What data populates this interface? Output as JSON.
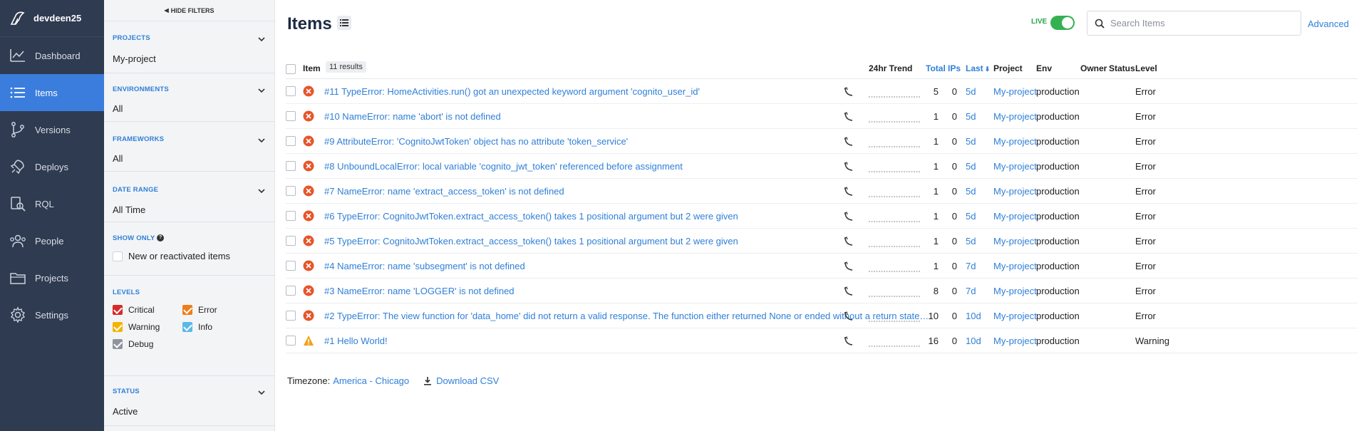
{
  "nav": {
    "account": "devdeen25",
    "items": [
      {
        "label": "Dashboard",
        "icon": "chart-line-icon"
      },
      {
        "label": "Items",
        "icon": "list-icon",
        "active": true
      },
      {
        "label": "Versions",
        "icon": "branch-icon"
      },
      {
        "label": "Deploys",
        "icon": "rocket-icon"
      },
      {
        "label": "RQL",
        "icon": "query-icon"
      },
      {
        "label": "People",
        "icon": "people-icon"
      },
      {
        "label": "Projects",
        "icon": "folder-icon"
      },
      {
        "label": "Settings",
        "icon": "gear-icon"
      }
    ]
  },
  "filters": {
    "hide_label": "HIDE FILTERS",
    "projects": {
      "title": "PROJECTS",
      "value": "My-project"
    },
    "environments": {
      "title": "ENVIRONMENTS",
      "value": "All"
    },
    "frameworks": {
      "title": "FRAMEWORKS",
      "value": "All"
    },
    "date_range": {
      "title": "DATE RANGE",
      "value": "All Time"
    },
    "show_only": {
      "title": "SHOW ONLY",
      "option": "New or reactivated items",
      "checked": false
    },
    "levels": {
      "title": "LEVELS",
      "items": [
        {
          "label": "Critical",
          "color": "#d62b2b",
          "checked": true
        },
        {
          "label": "Error",
          "color": "#f07c1b",
          "checked": true
        },
        {
          "label": "Warning",
          "color": "#f4b400",
          "checked": true
        },
        {
          "label": "Info",
          "color": "#5bb9e6",
          "checked": true
        },
        {
          "label": "Debug",
          "color": "#8f959e",
          "checked": true
        }
      ]
    },
    "status": {
      "title": "STATUS",
      "value": "Active"
    }
  },
  "main": {
    "title": "Items",
    "live_label": "LIVE",
    "live_on": true,
    "search_placeholder": "Search Items",
    "advanced_label": "Advanced",
    "columns": {
      "item": "Item",
      "results": "11 results",
      "trend": "24hr Trend",
      "total": "Total",
      "ips": "IPs",
      "last": "Last",
      "project": "Project",
      "env": "Env",
      "owner": "Owner",
      "status": "Status",
      "level": "Level"
    },
    "rows": [
      {
        "title": "#11 TypeError: HomeActivities.run() got an unexpected keyword argument 'cognito_user_id'",
        "total": "5",
        "ips": "0",
        "last": "5d",
        "project": "My-project",
        "env": "production",
        "level": "Error",
        "kind": "error"
      },
      {
        "title": "#10 NameError: name 'abort' is not defined",
        "total": "1",
        "ips": "0",
        "last": "5d",
        "project": "My-project",
        "env": "production",
        "level": "Error",
        "kind": "error"
      },
      {
        "title": "#9 AttributeError: 'CognitoJwtToken' object has no attribute 'token_service'",
        "total": "1",
        "ips": "0",
        "last": "5d",
        "project": "My-project",
        "env": "production",
        "level": "Error",
        "kind": "error"
      },
      {
        "title": "#8 UnboundLocalError: local variable 'cognito_jwt_token' referenced before assignment",
        "total": "1",
        "ips": "0",
        "last": "5d",
        "project": "My-project",
        "env": "production",
        "level": "Error",
        "kind": "error"
      },
      {
        "title": "#7 NameError: name 'extract_access_token' is not defined",
        "total": "1",
        "ips": "0",
        "last": "5d",
        "project": "My-project",
        "env": "production",
        "level": "Error",
        "kind": "error"
      },
      {
        "title": "#6 TypeError: CognitoJwtToken.extract_access_token() takes 1 positional argument but 2 were given",
        "total": "1",
        "ips": "0",
        "last": "5d",
        "project": "My-project",
        "env": "production",
        "level": "Error",
        "kind": "error"
      },
      {
        "title": "#5 TypeError: CognitoJwtToken.extract_access_token() takes 1 positional argument but 2 were given",
        "total": "1",
        "ips": "0",
        "last": "5d",
        "project": "My-project",
        "env": "production",
        "level": "Error",
        "kind": "error"
      },
      {
        "title": "#4 NameError: name 'subsegment' is not defined",
        "total": "1",
        "ips": "0",
        "last": "7d",
        "project": "My-project",
        "env": "production",
        "level": "Error",
        "kind": "error"
      },
      {
        "title": "#3 NameError: name 'LOGGER' is not defined",
        "total": "8",
        "ips": "0",
        "last": "7d",
        "project": "My-project",
        "env": "production",
        "level": "Error",
        "kind": "error"
      },
      {
        "title": "#2 TypeError: The view function for 'data_home' did not return a valid response. The function either returned None or ended without a return state…",
        "total": "10",
        "ips": "0",
        "last": "10d",
        "project": "My-project",
        "env": "production",
        "level": "Error",
        "kind": "error"
      },
      {
        "title": "#1 Hello World!",
        "total": "16",
        "ips": "0",
        "last": "10d",
        "project": "My-project",
        "env": "production",
        "level": "Warning",
        "kind": "warning"
      }
    ],
    "footer": {
      "timezone_label": "Timezone:",
      "timezone_value": "America - Chicago",
      "download_label": "Download CSV"
    }
  }
}
